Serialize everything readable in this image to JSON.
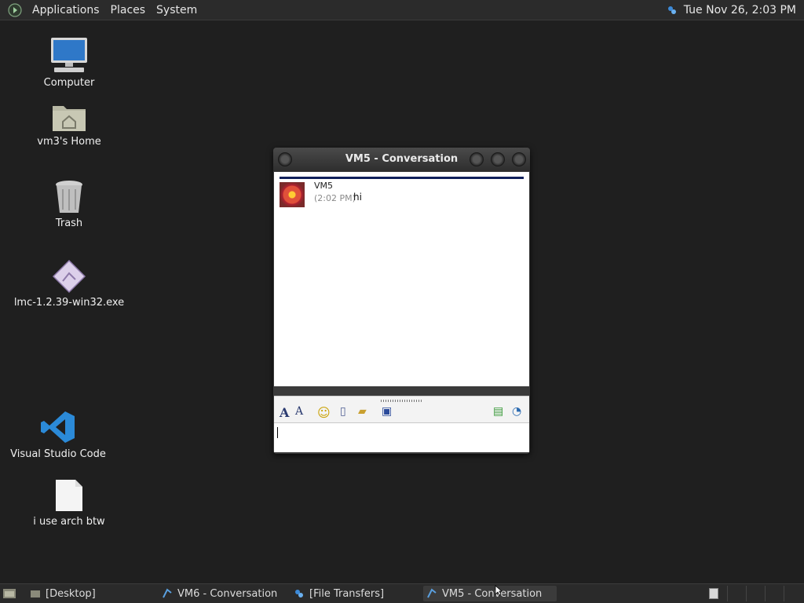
{
  "top_panel": {
    "menus": [
      "Applications",
      "Places",
      "System"
    ],
    "clock": "Tue Nov 26,  2:03 PM"
  },
  "desktop": {
    "icons": [
      {
        "label": "Computer",
        "icon": "computer-icon"
      },
      {
        "label": "vm3's Home",
        "icon": "home-folder-icon"
      },
      {
        "label": "Trash",
        "icon": "trash-icon"
      },
      {
        "label": "lmc-1.2.39-win32.exe",
        "icon": "executable-icon"
      },
      {
        "label": "Visual Studio Code",
        "icon": "vscode-icon"
      },
      {
        "label": "i use arch btw",
        "icon": "text-file-icon"
      }
    ]
  },
  "window": {
    "title": "VM5 - Conversation",
    "messages": [
      {
        "sender": "VM5",
        "time": "(2:02 PM)",
        "text": "hi"
      }
    ],
    "toolbar": [
      "font-icon",
      "font-size-icon",
      "smiley-icon",
      "attach-file-icon",
      "send-folder-icon",
      "save-icon",
      "add-contact-icon",
      "history-icon"
    ],
    "input_value": ""
  },
  "taskbar": {
    "items": [
      {
        "label": "[Desktop]",
        "active": false
      },
      {
        "label": "VM6 - Conversation",
        "active": false
      },
      {
        "label": "[File Transfers]",
        "active": false
      },
      {
        "label": "VM5 - Conversation",
        "active": true
      }
    ]
  },
  "colors": {
    "panel": "#2b2b2b",
    "desktop": "#1f1f1f",
    "conversation_rule": "#10205a",
    "vscode": "#2b8ad8"
  }
}
